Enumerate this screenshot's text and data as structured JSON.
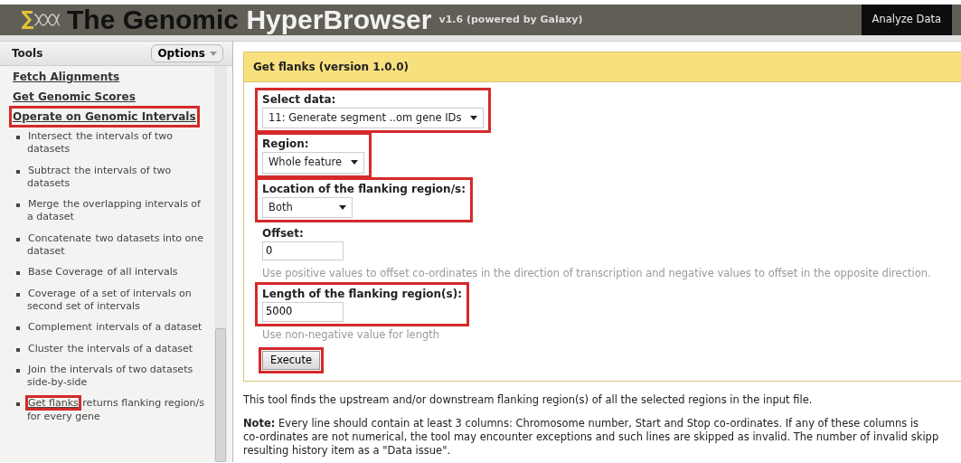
{
  "masthead": {
    "title_dark": "The Genomic",
    "title_light": "HyperBrowser",
    "version": "v1.6 (powered by Galaxy)",
    "nav_button": "Analyze Data"
  },
  "tool_panel": {
    "title": "Tools",
    "options_button": "Options",
    "items": [
      {
        "kind": "section",
        "label": "Fetch Alignments",
        "highlighted": false
      },
      {
        "kind": "section",
        "label": "Get Genomic Scores",
        "highlighted": false
      },
      {
        "kind": "section",
        "label": "Operate on Genomic Intervals",
        "highlighted": true
      },
      {
        "kind": "tool",
        "link": "Intersect",
        "description": "the intervals of two datasets",
        "highlighted": false
      },
      {
        "kind": "tool",
        "link": "Subtract",
        "description": "the intervals of two datasets",
        "highlighted": false
      },
      {
        "kind": "tool",
        "link": "Merge",
        "description": "the overlapping intervals of a dataset",
        "highlighted": false
      },
      {
        "kind": "tool",
        "link": "Concatenate",
        "description": "two datasets into one dataset",
        "highlighted": false
      },
      {
        "kind": "tool",
        "link": "Base Coverage",
        "description": "of all intervals",
        "highlighted": false
      },
      {
        "kind": "tool",
        "link": "Coverage",
        "description": "of a set of intervals on second set of intervals",
        "highlighted": false
      },
      {
        "kind": "tool",
        "link": "Complement",
        "description": "intervals of a dataset",
        "highlighted": false
      },
      {
        "kind": "tool",
        "link": "Cluster",
        "description": "the intervals of a dataset",
        "highlighted": false
      },
      {
        "kind": "tool",
        "link": "Join",
        "description": "the intervals of two datasets side-by-side",
        "highlighted": false
      },
      {
        "kind": "tool",
        "link": "Get flanks",
        "description": "returns flanking region/s for every gene",
        "highlighted": true
      }
    ]
  },
  "tool_form": {
    "title": "Get flanks (version 1.0.0)",
    "fields": [
      {
        "kind": "select",
        "label": "Select data:",
        "value": "11: Generate segment ..om gene IDs",
        "highlighted": true
      },
      {
        "kind": "select",
        "label": "Region:",
        "value": "Whole feature",
        "highlighted": true
      },
      {
        "kind": "select",
        "label": "Location of the flanking region/s:",
        "value": "Both",
        "highlighted": true
      },
      {
        "kind": "text",
        "label": "Offset:",
        "value": "0",
        "help": "Use positive values to offset co-ordinates in the direction of transcription and negative values to offset in the opposite direction.",
        "highlighted": false
      },
      {
        "kind": "text",
        "label": "Length of the flanking region(s):",
        "value": "5000",
        "help": "Use non-negative value for length",
        "highlighted": true
      }
    ],
    "execute": {
      "label": "Execute",
      "highlighted": true
    }
  },
  "help": {
    "intro": "This tool finds the upstream and/or downstream flanking region(s) of all the selected regions in the input file.",
    "note_lines": [
      "**Note:** Every line should contain at least 3 columns: Chromosome number, Start and Stop co-ordinates. If any of these columns is",
      "co-ordinates are not numerical, the tool may encounter exceptions and such lines are skipped as invalid. The number of invalid skipp",
      "resulting history item as a \"Data issue\"."
    ]
  }
}
